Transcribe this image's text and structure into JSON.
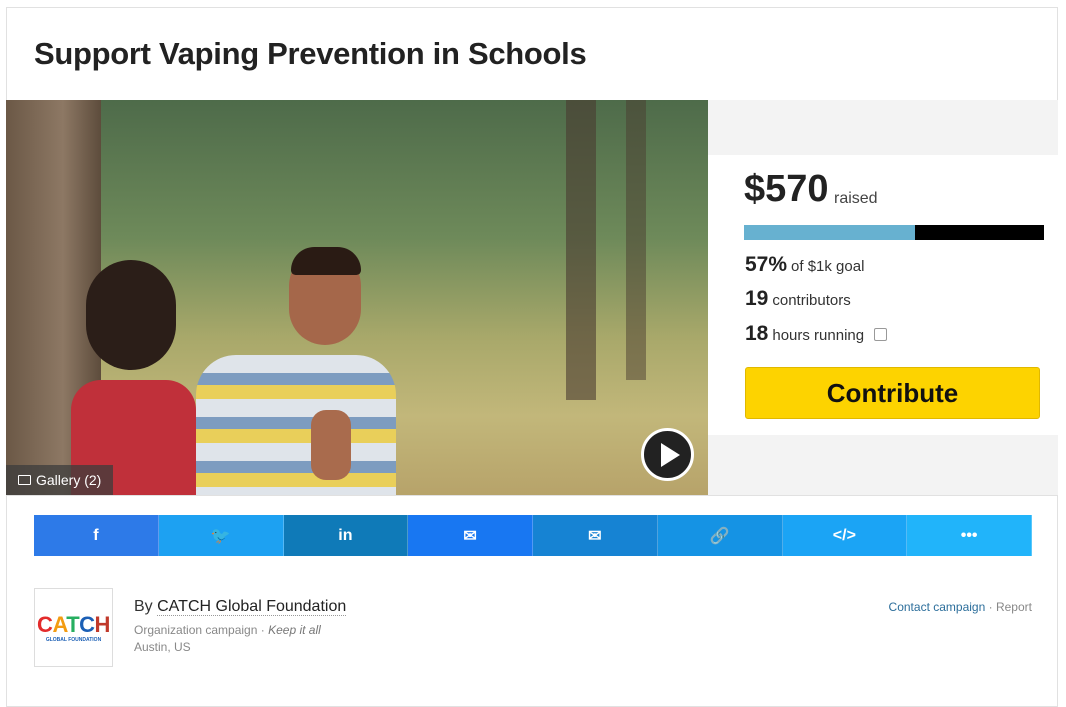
{
  "campaign": {
    "title": "Support Vaping Prevention in Schools"
  },
  "media": {
    "gallery_label": "Gallery (2)",
    "gallery_icon": "image-icon",
    "play_icon": "play-icon"
  },
  "funding": {
    "amount": "$570",
    "raised_label": "raised",
    "progress_fraction": 0.57,
    "percent": "57%",
    "goal_label": "of $1k goal",
    "contributors_count": "19",
    "contributors_label": "contributors",
    "hours_count": "18",
    "hours_label": "hours running",
    "calendar_icon": "calendar-icon",
    "contribute_label": "Contribute",
    "colors": {
      "progress": "#67b1d0",
      "button": "#fdd300"
    }
  },
  "share": {
    "buttons": [
      {
        "name": "facebook",
        "glyph": "f",
        "color": "#2d7ae8"
      },
      {
        "name": "twitter",
        "glyph": "🐦",
        "color": "#1da1f2"
      },
      {
        "name": "linkedin",
        "glyph": "in",
        "color": "#0f7ab8"
      },
      {
        "name": "messenger",
        "glyph": "✉",
        "color": "#1877f2"
      },
      {
        "name": "email",
        "glyph": "✉",
        "color": "#1683d3"
      },
      {
        "name": "link",
        "glyph": "🔗",
        "color": "#1593e4"
      },
      {
        "name": "embed",
        "glyph": "</>",
        "color": "#1ba4f5"
      },
      {
        "name": "more",
        "glyph": "•••",
        "color": "#21b4fa"
      }
    ]
  },
  "organizer": {
    "logo_text": "CATCH",
    "logo_subtext": "GLOBAL FOUNDATION",
    "by_prefix": "By",
    "name": "CATCH Global Foundation",
    "type": "Organization campaign",
    "separator": "·",
    "funding_model": "Keep it all",
    "location": "Austin, US",
    "contact_label": "Contact campaign",
    "report_label": "Report"
  }
}
